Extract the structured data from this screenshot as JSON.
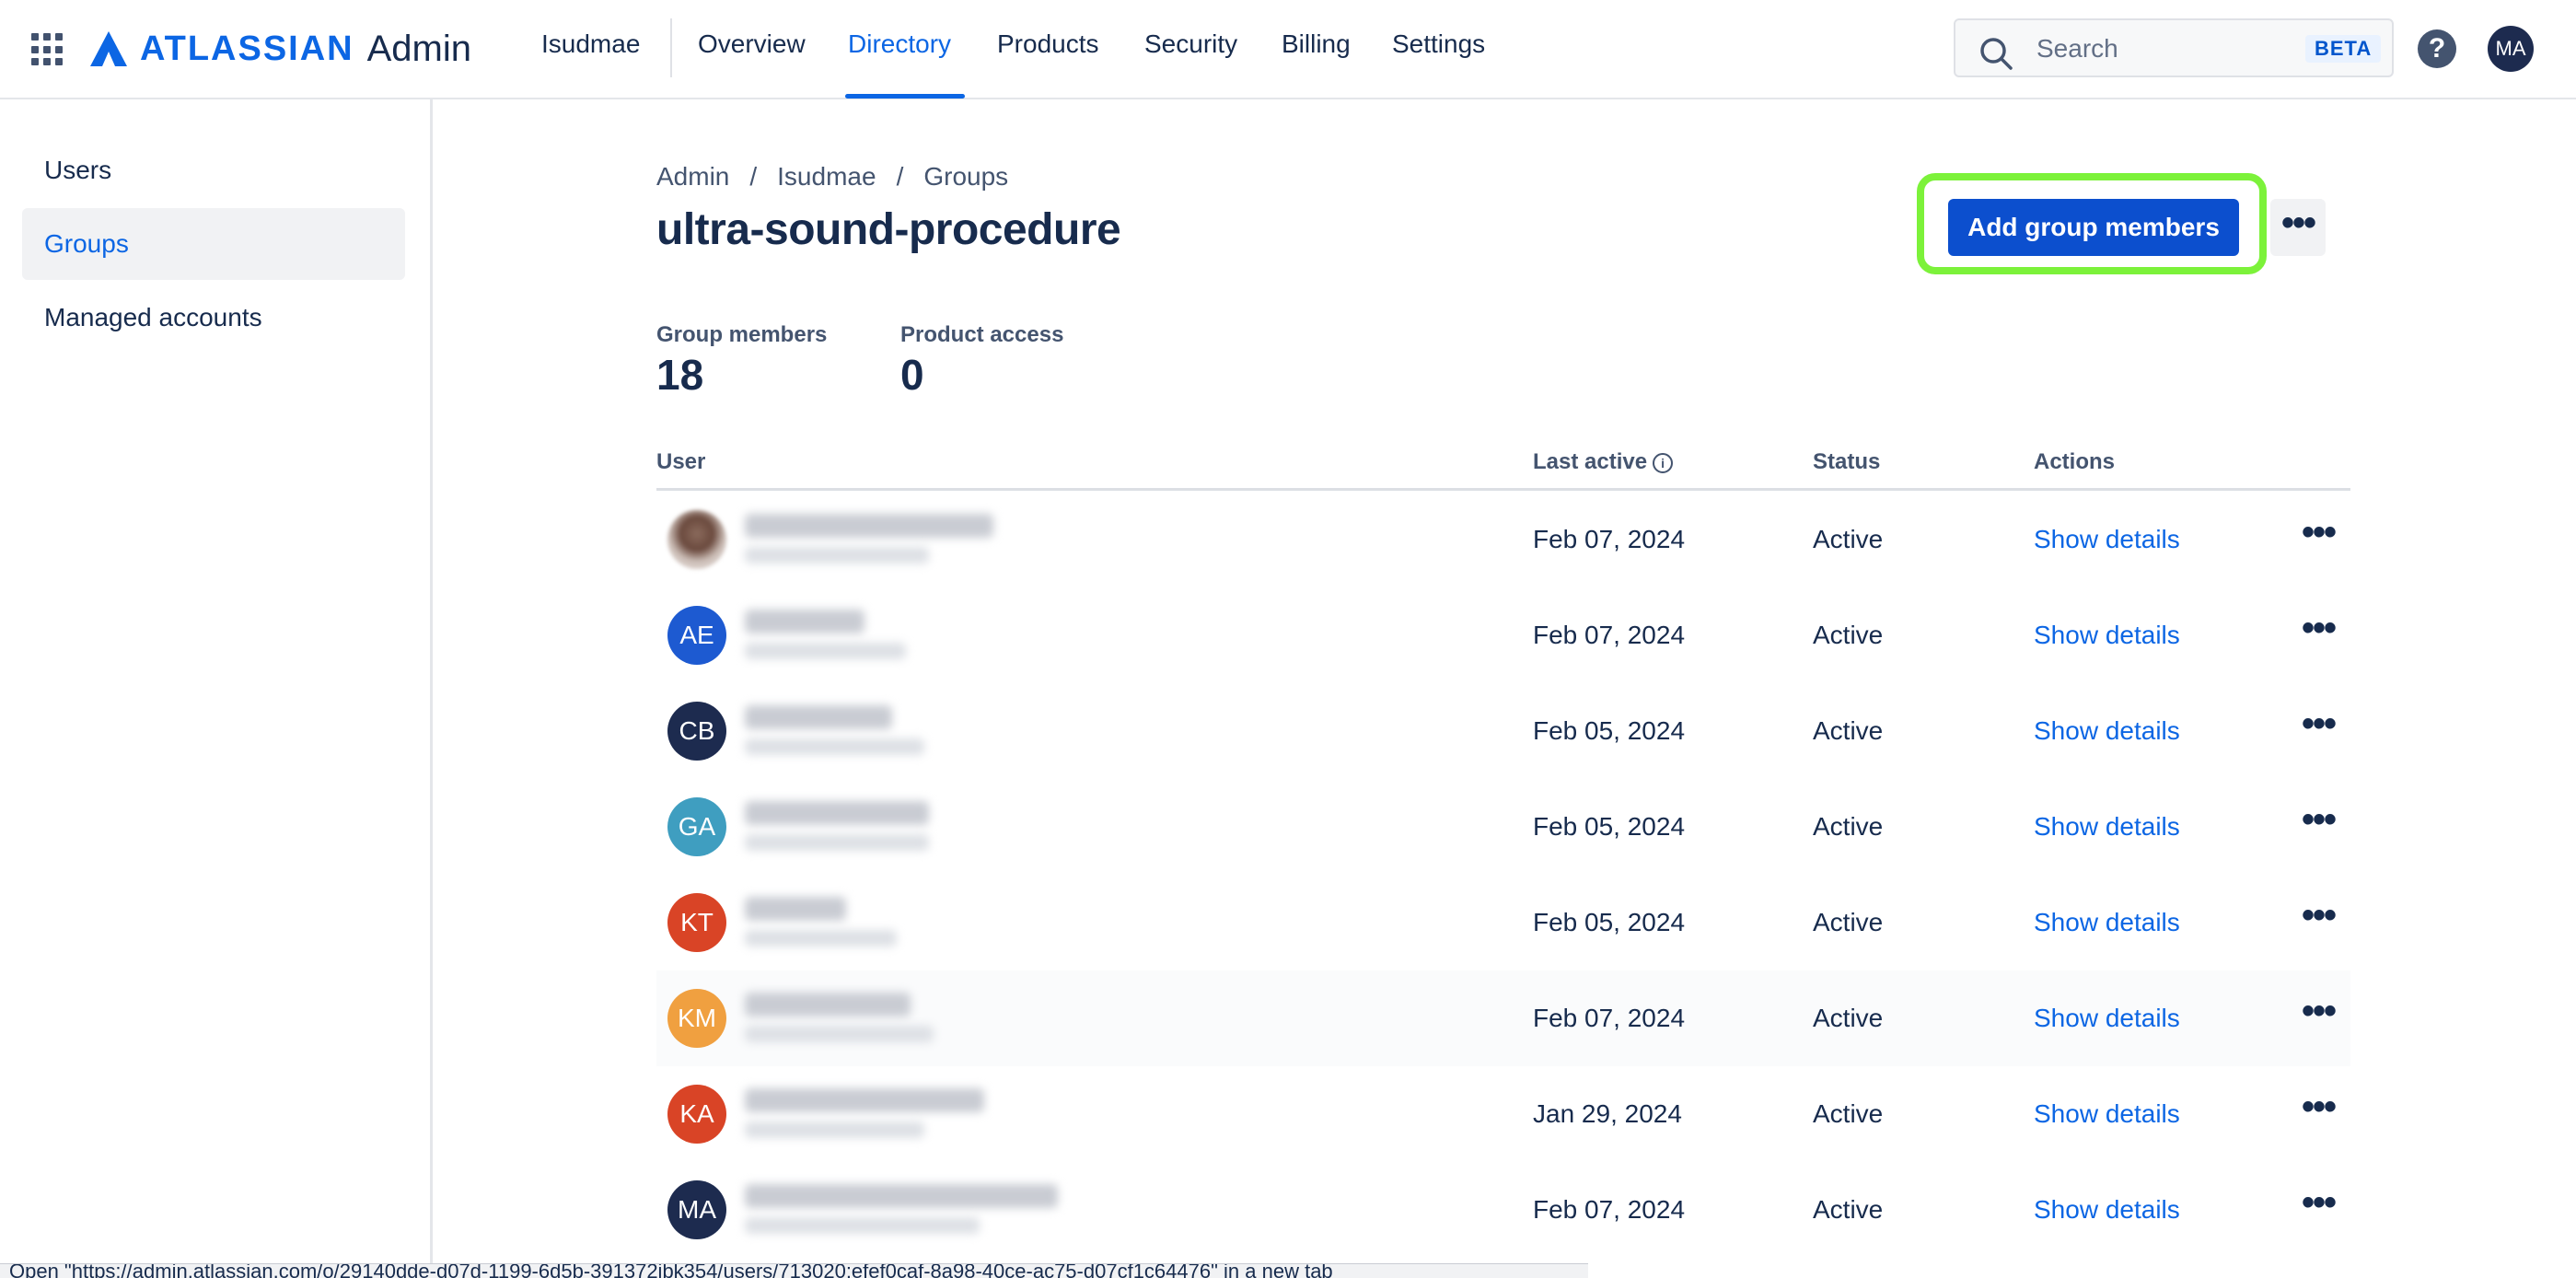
{
  "topnav": {
    "product": "Admin",
    "logo_word": "ATLASSIAN",
    "org": "Isudmae",
    "items": [
      "Overview",
      "Directory",
      "Products",
      "Security",
      "Billing",
      "Settings"
    ],
    "active_item": "Directory",
    "search": {
      "placeholder": "Search",
      "badge": "BETA"
    },
    "help_icon": "help-icon",
    "profile_initials": "MA"
  },
  "sidebar": {
    "items": [
      {
        "label": "Users",
        "active": false
      },
      {
        "label": "Groups",
        "active": true
      },
      {
        "label": "Managed accounts",
        "active": false
      }
    ]
  },
  "breadcrumb": [
    "Admin",
    "Isudmae",
    "Groups"
  ],
  "page_title": "ultra-sound-procedure",
  "actions": {
    "primary": "Add group members",
    "more_icon": "more-icon"
  },
  "stats": [
    {
      "label": "Group members",
      "value": "18"
    },
    {
      "label": "Product access",
      "value": "0"
    }
  ],
  "table": {
    "columns": [
      "User",
      "Last active",
      "Status",
      "Actions"
    ],
    "rows": [
      {
        "initials": "",
        "avatar_color": "#7a5a4e",
        "photo": true,
        "last_active": "Feb 07, 2024",
        "status": "Active",
        "action": "Show details"
      },
      {
        "initials": "AE",
        "avatar_color": "#1d5ad1",
        "photo": false,
        "last_active": "Feb 07, 2024",
        "status": "Active",
        "action": "Show details"
      },
      {
        "initials": "CB",
        "avatar_color": "#1d2b4f",
        "photo": false,
        "last_active": "Feb 05, 2024",
        "status": "Active",
        "action": "Show details"
      },
      {
        "initials": "GA",
        "avatar_color": "#3f9ec0",
        "photo": false,
        "last_active": "Feb 05, 2024",
        "status": "Active",
        "action": "Show details"
      },
      {
        "initials": "KT",
        "avatar_color": "#d94426",
        "photo": false,
        "last_active": "Feb 05, 2024",
        "status": "Active",
        "action": "Show details"
      },
      {
        "initials": "KM",
        "avatar_color": "#f0a040",
        "photo": false,
        "last_active": "Feb 07, 2024",
        "status": "Active",
        "action": "Show details"
      },
      {
        "initials": "KA",
        "avatar_color": "#d94426",
        "photo": false,
        "last_active": "Jan 29, 2024",
        "status": "Active",
        "action": "Show details"
      },
      {
        "initials": "MA",
        "avatar_color": "#1d2b4f",
        "photo": false,
        "last_active": "Feb 07, 2024",
        "status": "Active",
        "action": "Show details"
      }
    ]
  },
  "status_bar": "Open \"https://admin.atlassian.com/o/29140dde-d07d-1199-6d5b-391372ibk354/users/713020:efef0caf-8a98-40ce-ac75-d07cf1c64476\" in a new tab"
}
